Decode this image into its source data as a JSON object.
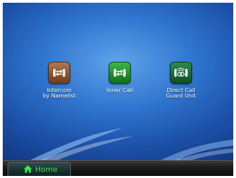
{
  "apps": [
    {
      "label_line1": "Intercom",
      "label_line2": "by Namelist",
      "icon": "intercom-handset-icon",
      "color": "#8a5532"
    },
    {
      "label_line1": "Inner Call",
      "label_line2": "",
      "icon": "inner-call-handset-icon",
      "color": "#1f8f2b"
    },
    {
      "label_line1": "Direct Call",
      "label_line2": "Guard Unit",
      "icon": "guard-unit-handset-icon",
      "color": "#1a6a3a"
    }
  ],
  "bottom_bar": {
    "home_label": "Home",
    "home_icon": "home-icon",
    "accent_color": "#3fe04a"
  }
}
